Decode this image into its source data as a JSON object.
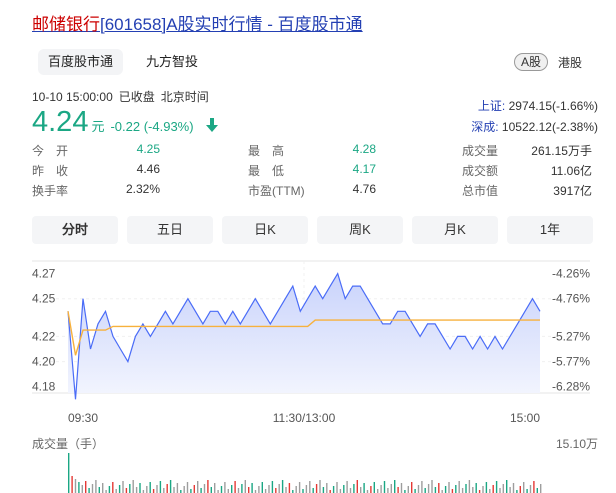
{
  "title": {
    "name": "邮储银行",
    "code": "[601658]",
    "suffix": "A股实时行情 - 百度股市通"
  },
  "tabs": [
    {
      "label": "百度股市通",
      "active": true
    },
    {
      "label": "九方智投",
      "active": false
    }
  ],
  "markets": {
    "a": "A股",
    "hk": "港股"
  },
  "time": {
    "datetime": "10-10 15:00:00",
    "status": "已收盘",
    "zone": "北京时间"
  },
  "quote": {
    "price": "4.24",
    "unit": "元",
    "change": "-0.22 (-4.93%)",
    "color": "#1ba784"
  },
  "indices": [
    {
      "name": "上证:",
      "value": "2974.15(-1.66%)"
    },
    {
      "name": "深成:",
      "value": "10522.12(-2.38%)"
    }
  ],
  "stats": [
    [
      {
        "label": "今　开",
        "value": "4.25",
        "green": true
      },
      {
        "label": "最　高",
        "value": "4.28",
        "green": true
      },
      {
        "label": "成交量",
        "value": "261.15万手",
        "green": false
      }
    ],
    [
      {
        "label": "昨　收",
        "value": "4.46",
        "green": false
      },
      {
        "label": "最　低",
        "value": "4.17",
        "green": true
      },
      {
        "label": "成交额",
        "value": "11.06亿",
        "green": false
      }
    ],
    [
      {
        "label": "换手率",
        "value": "2.32%",
        "green": false
      },
      {
        "label": "市盈(TTM)",
        "value": "4.76",
        "green": false
      },
      {
        "label": "总市值",
        "value": "3917亿",
        "green": false
      }
    ]
  ],
  "periods": [
    "分时",
    "五日",
    "日K",
    "周K",
    "月K",
    "1年"
  ],
  "active_period": 0,
  "chart": {
    "y_left": [
      "4.27",
      "4.25",
      "4.22",
      "4.20",
      "4.18"
    ],
    "y_right": [
      "-4.26%",
      "-4.76%",
      "-5.27%",
      "-5.77%",
      "-6.28%"
    ],
    "x_labels": [
      "09:30",
      "11:30/13:00",
      "15:00"
    ],
    "volume_label": "成交量（手）",
    "volume_max": "15.10万"
  },
  "chart_data": {
    "type": "line",
    "ylim": [
      4.175,
      4.28
    ],
    "prev_close": 4.46,
    "series": [
      {
        "values": [
          4.24,
          4.17,
          4.25,
          4.21,
          4.23,
          4.24,
          4.22,
          4.21,
          4.2,
          4.22,
          4.23,
          4.22,
          4.23,
          4.24,
          4.23,
          4.24,
          4.25,
          4.24,
          4.23,
          4.24,
          4.24,
          4.23,
          4.24,
          4.23,
          4.24,
          4.25,
          4.24,
          4.23,
          4.24,
          4.25,
          4.26,
          4.24,
          4.25,
          4.26,
          4.25,
          4.26,
          4.27,
          4.25,
          4.26,
          4.26,
          4.25,
          4.24,
          4.23,
          4.23,
          4.24,
          4.24,
          4.23,
          4.22,
          4.23,
          4.23,
          4.22,
          4.21,
          4.22,
          4.22,
          4.21,
          4.22,
          4.21,
          4.22,
          4.21,
          4.22,
          4.23,
          4.24,
          4.25,
          4.24
        ]
      },
      {
        "values": [
          4.24,
          4.205,
          4.225,
          4.225,
          4.225,
          4.225,
          4.228,
          4.228,
          4.228,
          4.228,
          4.228,
          4.228,
          4.228,
          4.228,
          4.228,
          4.228,
          4.228,
          4.228,
          4.228,
          4.228,
          4.228,
          4.228,
          4.228,
          4.228,
          4.228,
          4.228,
          4.228,
          4.228,
          4.228,
          4.228,
          4.228,
          4.228,
          4.228,
          4.233,
          4.233,
          4.233,
          4.233,
          4.233,
          4.233,
          4.233,
          4.233,
          4.233,
          4.233,
          4.233,
          4.233,
          4.233,
          4.233,
          4.233,
          4.233,
          4.233,
          4.233,
          4.233,
          4.233,
          4.233,
          4.233,
          4.233,
          4.233,
          4.233,
          4.233,
          4.233,
          4.233,
          4.233,
          4.233,
          4.233
        ]
      }
    ]
  },
  "colors": {
    "line": "#4a6cf7",
    "avg": "#f7b13d",
    "down": "#1ba784",
    "up": "#e53935",
    "grid": "#e6e6e6"
  }
}
